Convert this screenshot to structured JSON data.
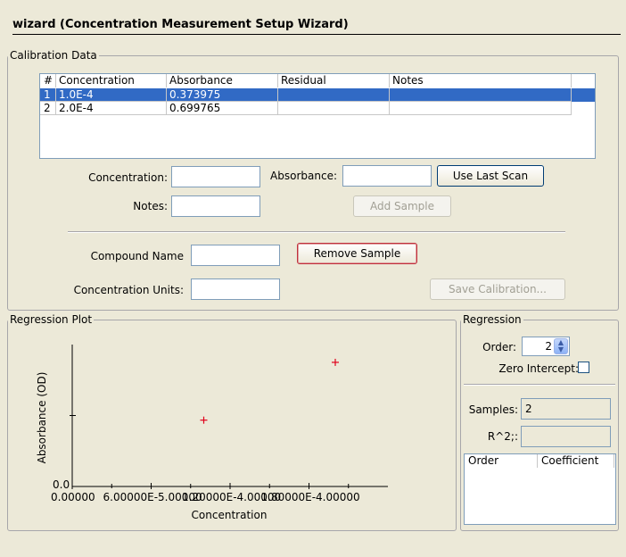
{
  "window": {
    "title": "wizard (Concentration Measurement Setup Wizard)"
  },
  "calibration": {
    "group_label": "Calibration Data",
    "columns": [
      "#",
      "Concentration",
      "Absorbance",
      "Residual",
      "Notes"
    ],
    "rows": [
      {
        "num": "1",
        "concentration": "1.0E-4",
        "absorbance": "0.373975",
        "residual": "",
        "notes": ""
      },
      {
        "num": "2",
        "concentration": "2.0E-4",
        "absorbance": "0.699765",
        "residual": "",
        "notes": ""
      }
    ],
    "selected_row": 0,
    "concentration_label": "Concentration:",
    "concentration_value": "",
    "absorbance_label": "Absorbance:",
    "absorbance_value": "",
    "use_last_scan_label": "Use Last Scan",
    "notes_label": "Notes:",
    "notes_value": "",
    "add_sample_label": "Add Sample",
    "compound_name_label": "Compound Name",
    "compound_name_value": "",
    "remove_sample_label": "Remove Sample",
    "units_label": "Concentration Units:",
    "units_value": "",
    "save_calibration_label": "Save Calibration..."
  },
  "plot": {
    "group_label": "Regression Plot"
  },
  "chart_data": {
    "type": "scatter",
    "xlabel": "Concentration",
    "ylabel": "Absorbance (OD)",
    "x_tick_labels": [
      "0.00000",
      "6.00000E-5.00000",
      "1.20000E-4.00000",
      "1.80000E-4.00000"
    ],
    "y_tick_labels": [
      "0.0"
    ],
    "xlim": [
      0,
      0.00024
    ],
    "ylim": [
      0,
      0.8
    ],
    "series": [
      {
        "x": [
          0.0001,
          0.0002
        ],
        "y": [
          0.373975,
          0.699765
        ],
        "marker": "+",
        "color": "#e0001b"
      }
    ],
    "grid": false
  },
  "regression": {
    "group_label": "Regression",
    "order_label": "Order:",
    "order_value": "2",
    "zero_intercept_label": "Zero Intercept:",
    "zero_intercept_checked": false,
    "samples_label": "Samples:",
    "samples_value": "2",
    "r2_label": "R^2;:",
    "r2_value": "",
    "coef_columns": [
      "Order",
      "Coefficient"
    ]
  }
}
